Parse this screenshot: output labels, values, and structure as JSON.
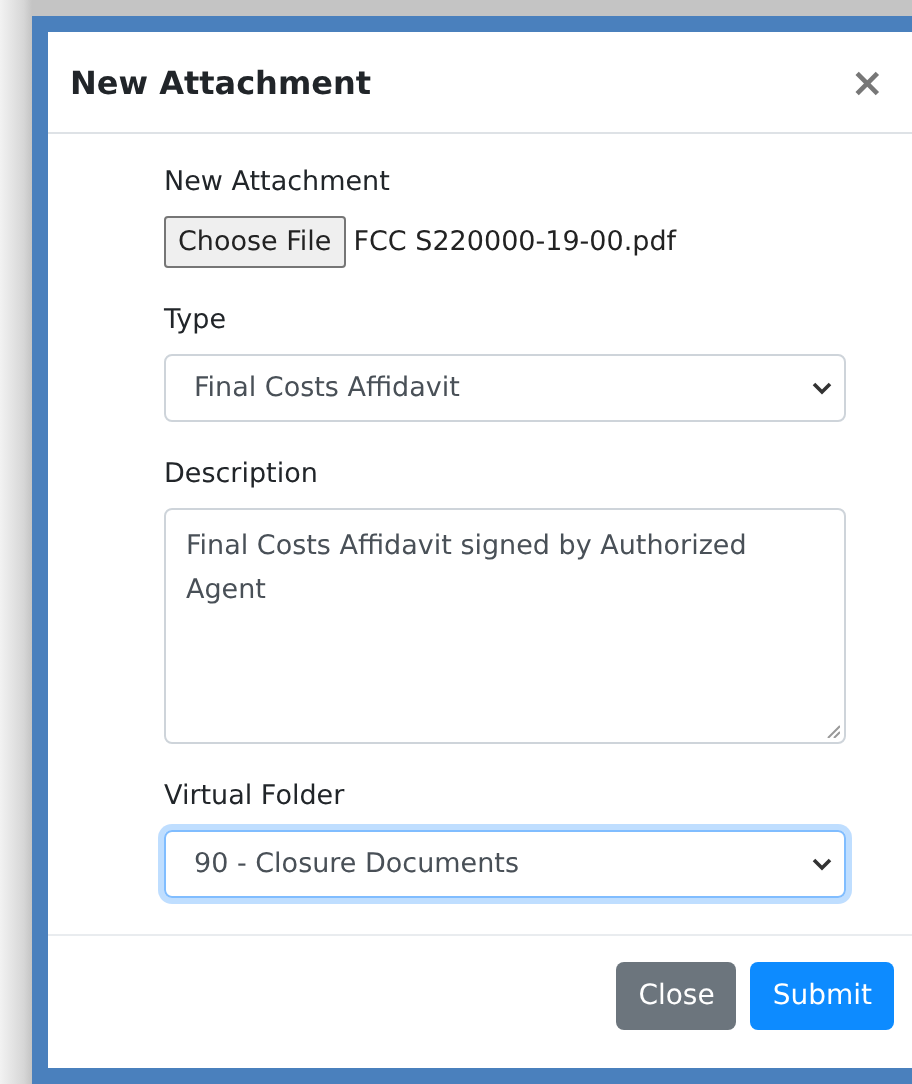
{
  "dialog": {
    "title": "New Attachment",
    "close_glyph": "×"
  },
  "fields": [
    {
      "kind": "file",
      "label": "New Attachment",
      "button": "Choose File",
      "value": "FCC S220000-19-00.pdf"
    },
    {
      "kind": "select",
      "label": "Type",
      "value": "Final Costs Affidavit",
      "focused": false
    },
    {
      "kind": "textarea",
      "label": "Description",
      "value": "Final Costs Affidavit signed by Authorized Agent"
    },
    {
      "kind": "select",
      "label": "Virtual Folder",
      "value": "90 - Closure Documents",
      "focused": true
    }
  ],
  "buttons": [
    {
      "label": "Close",
      "kind": "secondary"
    },
    {
      "label": "Submit",
      "kind": "primary"
    }
  ]
}
